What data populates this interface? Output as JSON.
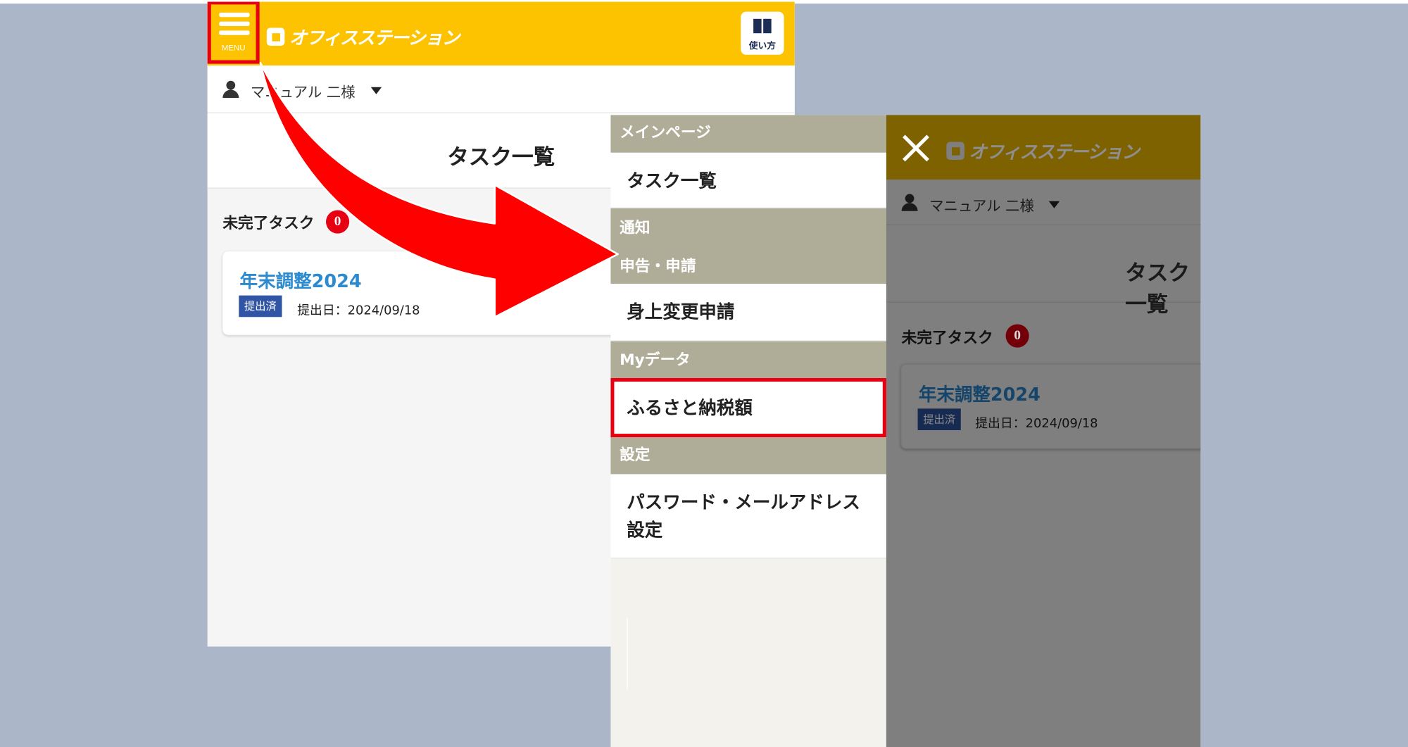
{
  "app": {
    "brand": "オフィスステーション",
    "menu_label": "MENU",
    "guide_label": "使い方",
    "user_name": "マニュアル 二様",
    "page_title": "タスク一覧",
    "pending_label": "未完了タスク",
    "pending_count": "0",
    "task": {
      "title": "年末調整2024",
      "status": "提出済",
      "date": "提出日：2024/09/18"
    }
  },
  "menu": {
    "h_main": "メインページ",
    "item_tasks": "タスク一覧",
    "h_notice": "通知",
    "h_apply": "申告・申請",
    "item_change": "身上変更申請",
    "h_mydata": "Myデータ",
    "item_furusato": "ふるさと納税額",
    "h_settings": "設定",
    "item_password": "パスワード・メールアドレス設定"
  },
  "colors": {
    "header": "#fec300",
    "highlight": "#e60012",
    "accent_link": "#2b8ad0",
    "menu_heading": "#afac97",
    "background": "#abb7c8"
  },
  "icons": [
    "hamburger-icon",
    "logo-icon",
    "book-icon",
    "user-icon",
    "caret-down-icon",
    "close-icon",
    "arrow-icon"
  ]
}
